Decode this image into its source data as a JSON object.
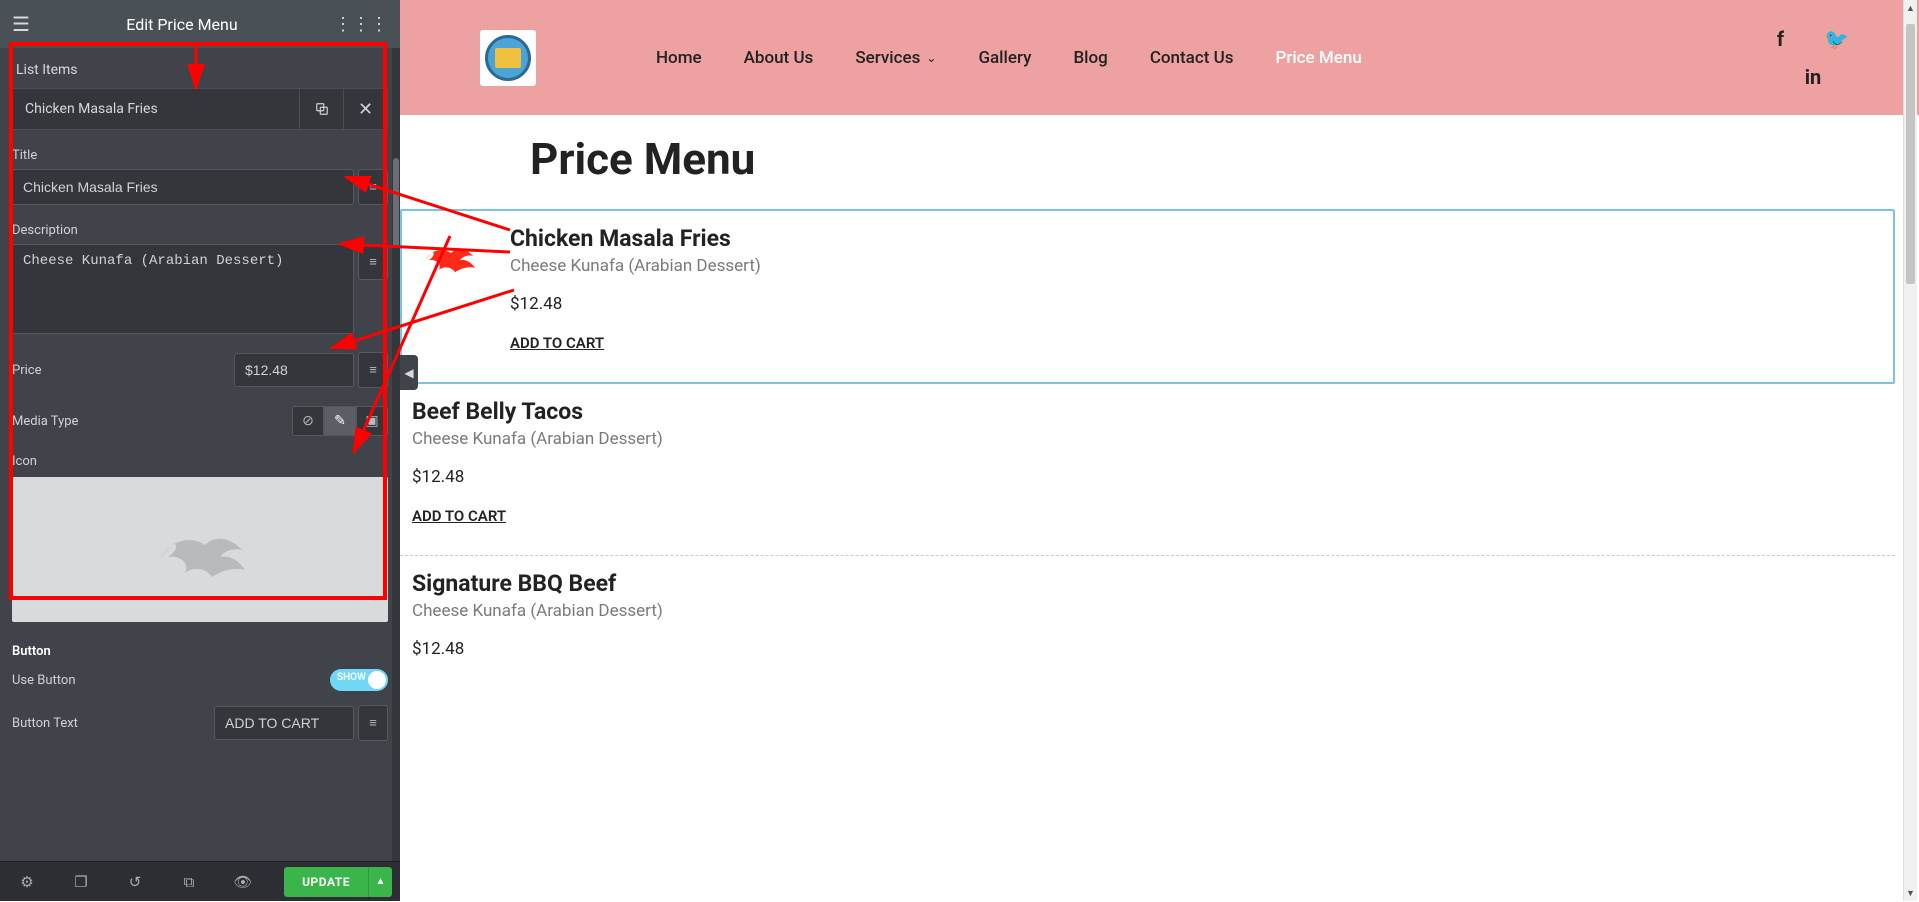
{
  "panel": {
    "title": "Edit Price Menu",
    "list_items_label": "List Items",
    "item_name": "Chicken Masala Fries",
    "fields": {
      "title_label": "Title",
      "title_value": "Chicken Masala Fries",
      "description_label": "Description",
      "description_value": "Cheese Kunafa (Arabian Dessert)",
      "price_label": "Price",
      "price_value": "$12.48",
      "media_type_label": "Media Type",
      "icon_label": "Icon",
      "button_label": "Button",
      "use_button_label": "Use Button",
      "use_button_show": "SHOW",
      "button_text_label": "Button Text",
      "button_text_value": "ADD TO CART"
    }
  },
  "footer": {
    "update": "UPDATE"
  },
  "site": {
    "nav": {
      "home": "Home",
      "about": "About Us",
      "services": "Services",
      "gallery": "Gallery",
      "blog": "Blog",
      "contact": "Contact Us",
      "price_menu": "Price Menu"
    },
    "page_title": "Price Menu",
    "items": [
      {
        "title": "Chicken Masala Fries",
        "desc": "Cheese Kunafa (Arabian Dessert)",
        "price": "$12.48",
        "btn": "ADD TO CART"
      },
      {
        "title": "Beef Belly Tacos",
        "desc": "Cheese Kunafa (Arabian Dessert)",
        "price": "$12.48",
        "btn": "ADD TO CART"
      },
      {
        "title": "Signature BBQ Beef",
        "desc": "Cheese Kunafa (Arabian Dessert)",
        "price": "$12.48",
        "btn": ""
      }
    ]
  }
}
